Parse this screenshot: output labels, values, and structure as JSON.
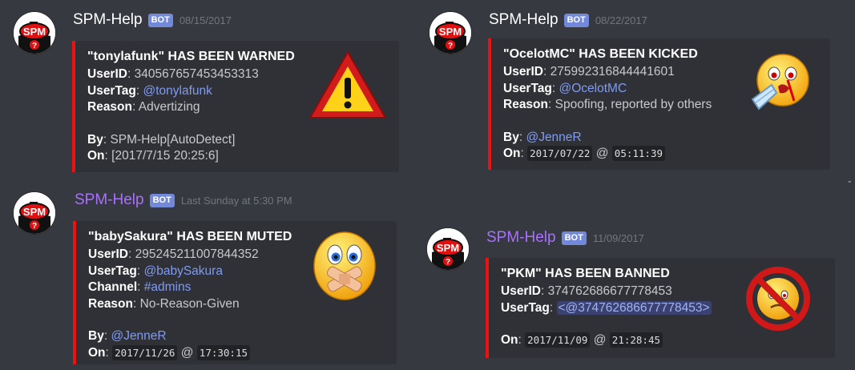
{
  "messages": [
    {
      "author": "SPM-Help",
      "badge": "BOT",
      "timestamp": "08/15/2017",
      "embed": {
        "title": "\"tonylafunk\" HAS BEEN WARNED",
        "userid_label": "UserID",
        "userid": "340567657453453313",
        "usertag_label": "UserTag",
        "usertag": "@tonylafunk",
        "reason_label": "Reason",
        "reason": "Advertizing",
        "by_label": "By",
        "by": "SPM-Help[AutoDetect]",
        "on_label": "On",
        "on": "[2017/7/15 20:25:6]"
      }
    },
    {
      "author": "SPM-Help",
      "badge": "BOT",
      "timestamp": "08/22/2017",
      "embed": {
        "title": "\"OcelotMC\" HAS BEEN KICKED",
        "userid_label": "UserID",
        "userid": "275992316844441601",
        "usertag_label": "UserTag",
        "usertag": "@OcelotMC",
        "reason_label": "Reason",
        "reason": "Spoofing, reported by others",
        "by_label": "By",
        "by": "@JenneR",
        "on_label": "On",
        "on_date": "2017/07/22",
        "on_at": "@",
        "on_time": "05:11:39"
      }
    },
    {
      "author": "SPM-Help",
      "badge": "BOT",
      "timestamp": "Last Sunday at 5:30 PM",
      "embed": {
        "title": "\"babySakura\" HAS BEEN MUTED",
        "userid_label": "UserID",
        "userid": "295245211007844352",
        "usertag_label": "UserTag",
        "usertag": "@babySakura",
        "channel_label": "Channel",
        "channel": "#admins",
        "reason_label": "Reason",
        "reason": "No-Reason-Given",
        "by_label": "By",
        "by": "@JenneR",
        "on_label": "On",
        "on_date": "2017/11/26",
        "on_at": "@",
        "on_time": "17:30:15"
      }
    },
    {
      "author": "SPM-Help",
      "badge": "BOT",
      "timestamp": "11/09/2017",
      "embed": {
        "title": "\"PKM\" HAS BEEN BANNED",
        "userid_label": "UserID",
        "userid": "374762686677778453",
        "usertag_label": "UserTag",
        "usertag": "<@374762686677778453>",
        "on_label": "On",
        "on_date": "2017/11/09",
        "on_at": "@",
        "on_time": "21:28:45"
      }
    }
  ],
  "avatar": {
    "text": "SPM",
    "sub": "?"
  },
  "colors": {
    "embed_border": "#ee1111",
    "bot_badge": "#7289da",
    "mention": "#7f9bf4",
    "author_alt": "#a970ff"
  },
  "icons": [
    "warning-icon",
    "crying-face-icon",
    "muted-face-icon",
    "banned-face-icon"
  ],
  "scroll_marker": "⌄"
}
